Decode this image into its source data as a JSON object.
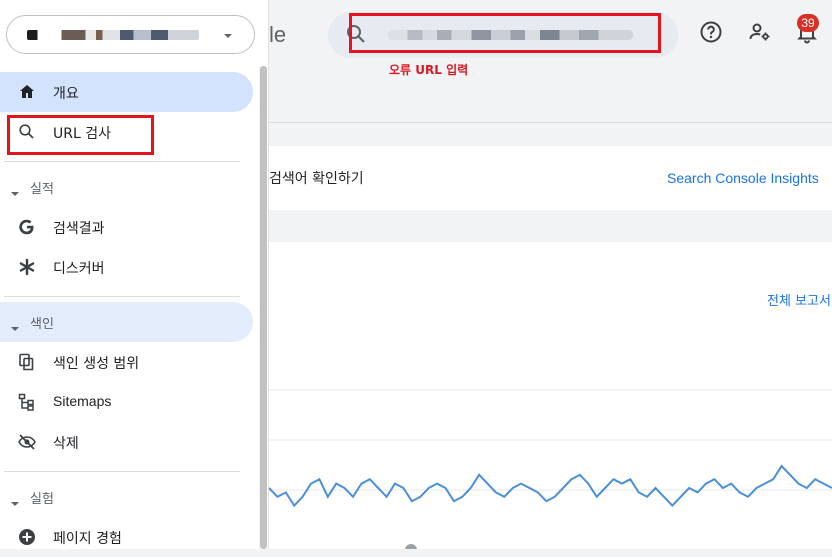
{
  "header": {
    "brand_fragment": "le",
    "search_placeholder_redacted": true,
    "annotation_note": "오류 URL 입력",
    "notification_count": "39",
    "icons": [
      "help-icon",
      "manage-users-icon",
      "notifications-icon"
    ]
  },
  "sidebar": {
    "property_selector": {
      "redacted": true
    },
    "items": [
      {
        "label": "개요",
        "icon": "home-icon",
        "active": true
      },
      {
        "label": "URL 검사",
        "icon": "search-icon",
        "active": false
      }
    ],
    "sections": [
      {
        "label": "실적",
        "items": [
          {
            "label": "검색결과",
            "icon": "google-g-icon"
          },
          {
            "label": "디스커버",
            "icon": "asterisk-icon"
          }
        ]
      },
      {
        "label": "색인",
        "active": true,
        "items": [
          {
            "label": "색인 생성 범위",
            "icon": "copy-pages-icon"
          },
          {
            "label": "Sitemaps",
            "icon": "sitemap-icon"
          },
          {
            "label": "삭제",
            "icon": "eye-off-icon"
          }
        ]
      },
      {
        "label": "실험",
        "items": [
          {
            "label": "페이지 경험",
            "icon": "plus-circle-icon"
          }
        ]
      }
    ]
  },
  "main": {
    "insights_card": {
      "text": "검색어 확인하기",
      "link": "Search Console Insights"
    },
    "report_card": {
      "link": "전체 보고서"
    }
  },
  "colors": {
    "accent": "#1a73e8",
    "active_nav": "#d3e3fd",
    "annotation_red": "#e3141e",
    "badge": "#d93025",
    "line": "#4a8fd9"
  },
  "chart_data": {
    "type": "line",
    "series": [
      {
        "values": [
          60,
          58,
          59,
          56,
          58,
          61,
          62,
          58,
          61,
          60,
          58,
          61,
          62,
          60,
          58,
          61,
          60,
          57,
          58,
          60,
          61,
          60,
          57,
          58,
          60,
          63,
          61,
          59,
          58,
          60,
          61,
          60,
          59,
          57,
          58,
          60,
          62,
          63,
          61,
          58,
          60,
          62,
          61,
          62,
          59,
          58,
          60,
          58,
          56,
          58,
          60,
          59,
          61,
          62,
          60,
          61,
          59,
          58,
          60,
          61,
          62,
          65,
          63,
          61,
          60,
          62,
          61,
          60
        ]
      }
    ]
  }
}
